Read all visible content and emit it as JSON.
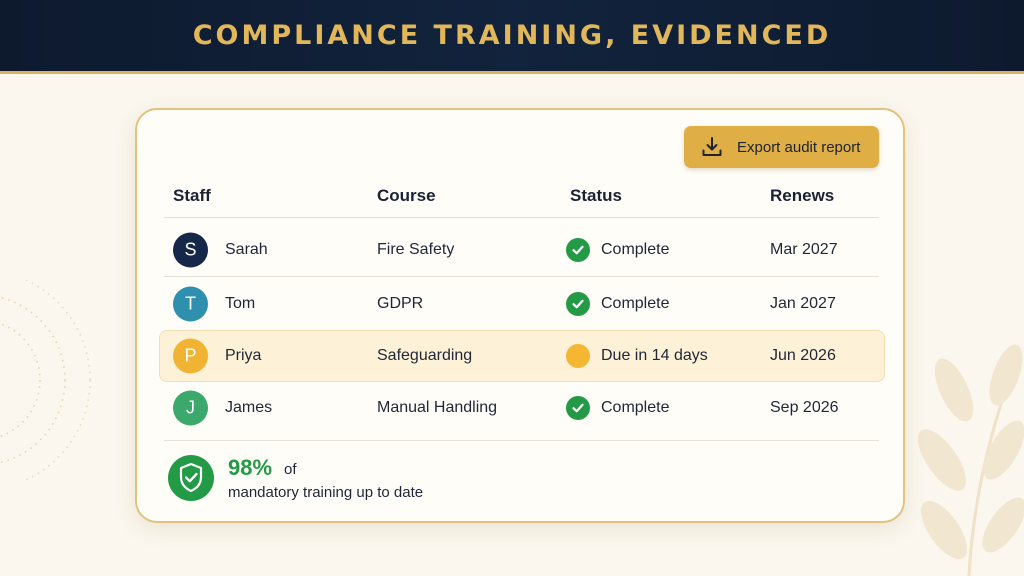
{
  "banner": {
    "title": "COMPLIANCE TRAINING, EVIDENCED"
  },
  "toolbar": {
    "export_label": "Export audit report"
  },
  "table": {
    "columns": [
      "Staff",
      "Course",
      "Status",
      "Renews"
    ],
    "rows": [
      {
        "initial": "S",
        "name": "Sarah",
        "course": "Fire Safety",
        "status": "Complete",
        "status_kind": "complete",
        "renews": "Mar 2027",
        "avatar_color": "#15284a"
      },
      {
        "initial": "T",
        "name": "Tom",
        "course": "GDPR",
        "status": "Complete",
        "status_kind": "complete",
        "renews": "Jan 2027",
        "avatar_color": "#2f8fae"
      },
      {
        "initial": "P",
        "name": "Priya",
        "course": "Safeguarding",
        "status": "Due in 14 days",
        "status_kind": "due",
        "renews": "Jun 2026",
        "avatar_color": "#f0b332"
      },
      {
        "initial": "J",
        "name": "James",
        "course": "Manual Handling",
        "status": "Complete",
        "status_kind": "complete",
        "renews": "Sep 2026",
        "avatar_color": "#3aa96b"
      }
    ]
  },
  "summary": {
    "percent": "98%",
    "of": "of",
    "text": "mandatory training up to date"
  },
  "colors": {
    "accent": "#dfae45",
    "banner": "#0f1f36",
    "success": "#239a45",
    "warning": "#f5b731"
  }
}
